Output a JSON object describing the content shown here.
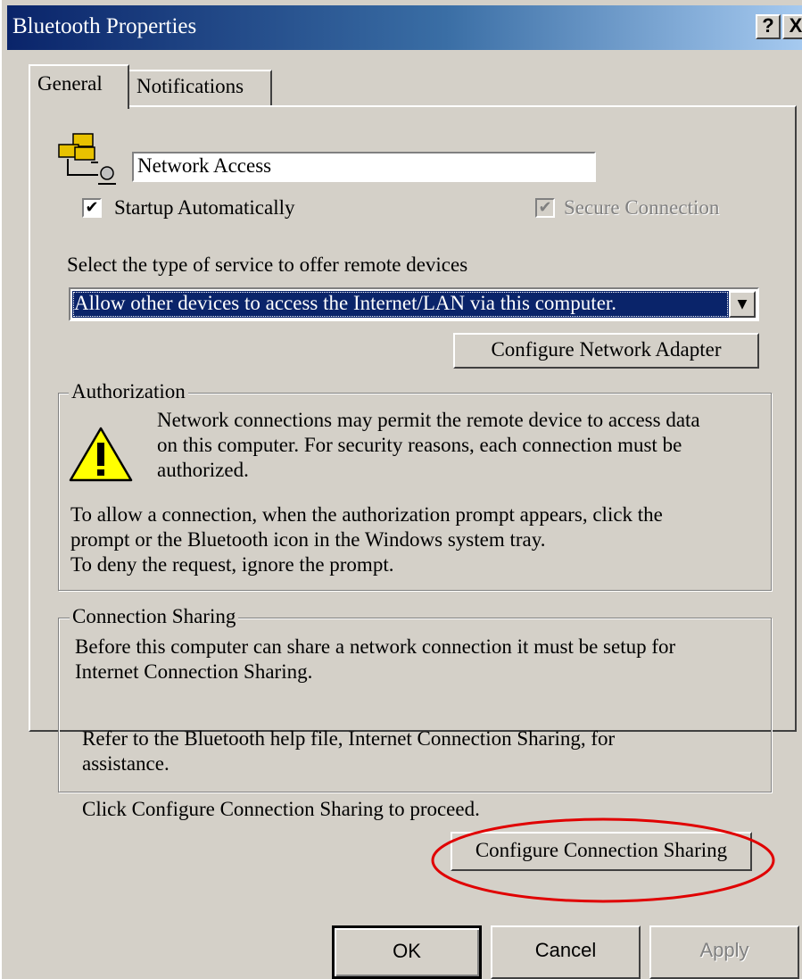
{
  "window": {
    "title": "Bluetooth Properties",
    "help_label": "?",
    "close_label": "X"
  },
  "tabs": [
    {
      "label": "General",
      "active": true
    },
    {
      "label": "Notifications",
      "active": false
    }
  ],
  "service": {
    "name_value": "Network Access",
    "startup_label": "Startup Automatically",
    "startup_checked": true,
    "secure_label": "Secure Connection",
    "secure_checked": true,
    "secure_disabled": true,
    "check_mark": "✔",
    "type_prompt": "Select the type of service to offer remote devices",
    "type_selected": "Allow other devices to access the Internet/LAN via this computer.",
    "dropdown_arrow": "▼",
    "configure_adapter_label": "Configure Network Adapter"
  },
  "authorization": {
    "legend": "Authorization",
    "warning_line1": "Network connections may permit the remote device to access data",
    "warning_line2": "on this computer.  For security reasons, each connection must be",
    "warning_line3": "authorized.",
    "info_line1": "To allow a connection, when the authorization prompt appears, click the",
    "info_line2": "prompt or the Bluetooth icon in the Windows system tray.",
    "info_line3": "To deny the request, ignore the prompt."
  },
  "connection_sharing": {
    "legend": "Connection Sharing",
    "para1_line1": "Before this computer can share a network connection it must be setup for",
    "para1_line2": "Internet Connection Sharing.",
    "para2_line1": "Refer to the Bluetooth help file, Internet Connection Sharing, for",
    "para2_line2": "assistance.",
    "para3": "Click Configure Connection Sharing to proceed.",
    "configure_label": "Configure Connection Sharing",
    "highlight_color": "#e00000"
  },
  "footer": {
    "ok_label": "OK",
    "cancel_label": "Cancel",
    "apply_label": "Apply",
    "apply_disabled": true
  }
}
